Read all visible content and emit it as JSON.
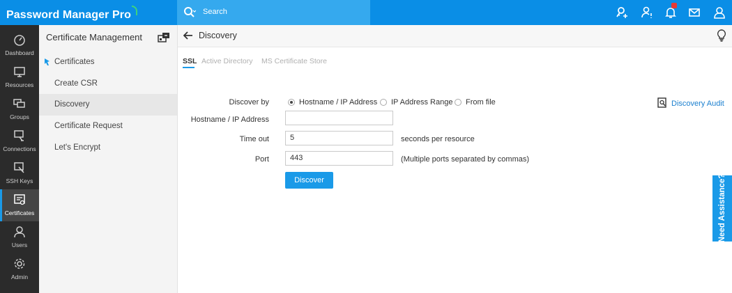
{
  "app": {
    "title": "Password Manager Pro"
  },
  "search": {
    "placeholder": "Search"
  },
  "topbar_icons": [
    "key-plus-icon",
    "user-alert-icon",
    "bell-icon",
    "mail-icon",
    "user-icon"
  ],
  "nav": {
    "items": [
      {
        "label": "Dashboard",
        "icon": "dashboard-icon"
      },
      {
        "label": "Resources",
        "icon": "monitor-icon"
      },
      {
        "label": "Groups",
        "icon": "groups-icon"
      },
      {
        "label": "Connections",
        "icon": "connections-icon"
      },
      {
        "label": "SSH Keys",
        "icon": "ssh-key-icon"
      },
      {
        "label": "Certificates",
        "icon": "certificate-icon",
        "active": true
      },
      {
        "label": "Users",
        "icon": "users-icon"
      },
      {
        "label": "Admin",
        "icon": "gear-icon"
      }
    ]
  },
  "subpanel": {
    "title": "Certificate Management",
    "items": [
      {
        "label": "Certificates",
        "pinned": true
      },
      {
        "label": "Create CSR"
      },
      {
        "label": "Discovery",
        "active": true
      },
      {
        "label": "Certificate Request"
      },
      {
        "label": "Let's Encrypt"
      }
    ]
  },
  "header": {
    "title": "Discovery"
  },
  "tabs": [
    {
      "label": "SSL",
      "active": true
    },
    {
      "label": "Active Directory"
    },
    {
      "label": "MS Certificate Store"
    }
  ],
  "form": {
    "discover_by_label": "Discover by",
    "options": [
      {
        "label": "Hostname / IP Address",
        "selected": true
      },
      {
        "label": "IP Address Range",
        "selected": false
      },
      {
        "label": "From file",
        "selected": false
      }
    ],
    "hostname_label": "Hostname / IP Address",
    "hostname_value": "",
    "timeout_label": "Time out",
    "timeout_value": "5",
    "timeout_hint": "seconds per resource",
    "port_label": "Port",
    "port_value": "443",
    "port_hint": "(Multiple ports separated by commas)",
    "discover_button": "Discover"
  },
  "discovery_audit": {
    "label": "Discovery Audit"
  },
  "assistance": {
    "label": "Need Assistance?"
  },
  "colors": {
    "topbar": "#0a8ee6",
    "accent": "#1a9ae8",
    "nav_bg": "#2b2b2b"
  }
}
